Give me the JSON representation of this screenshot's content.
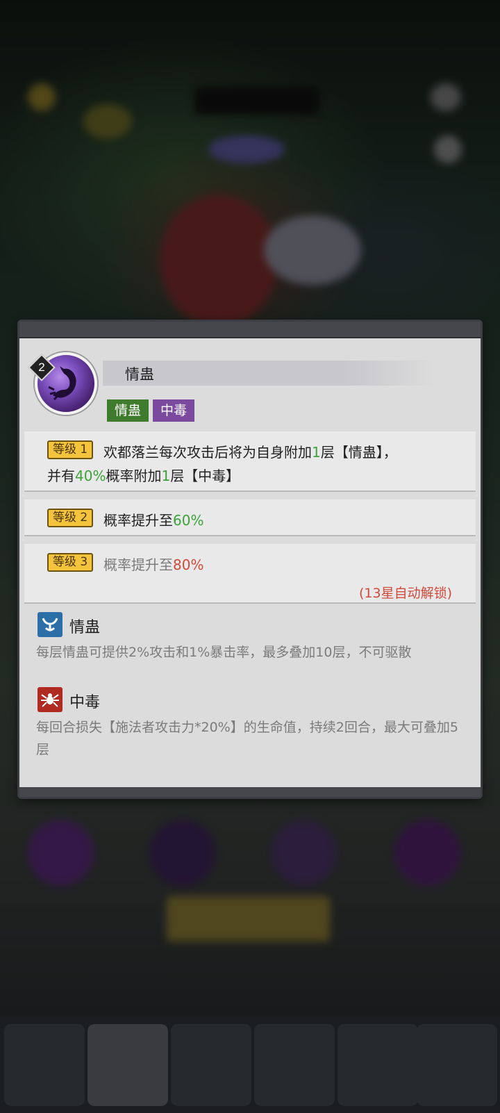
{
  "skill": {
    "level": "2",
    "name": "情蛊",
    "tags": [
      "情蛊",
      "中毒"
    ]
  },
  "levels": [
    {
      "badge": "等级 1",
      "line1": {
        "a": "欢都落兰每次攻击后将为自身附加",
        "b": "1",
        "c": "层【情蛊】，"
      },
      "line2": {
        "a": "并有",
        "b": "40%",
        "c": "概率附加",
        "d": "1",
        "e": "层【中毒】"
      }
    },
    {
      "badge": "等级 2",
      "line1": {
        "a": "概率提升至",
        "b": "60%"
      }
    },
    {
      "badge": "等级 3",
      "line1": {
        "a": "概率提升至",
        "b": "80%"
      },
      "note": "(13星自动解锁)"
    }
  ],
  "effects": [
    {
      "icon": "charm-icon",
      "title": "情蛊",
      "desc": "每层情蛊可提供2%攻击和1%暴击率，最多叠加10层，不可驱散"
    },
    {
      "icon": "spider-poison-icon",
      "title": "中毒",
      "desc": "每回合损失【施法者攻击力*20%】的生命值，持续2回合，最大可叠加5层"
    }
  ],
  "colors": {
    "tag_green": "#3f7b2d",
    "tag_purple": "#7b4a9e",
    "highlight_green": "#3ea13b",
    "highlight_red": "#cf4a3b",
    "badge_gold": "#f3c43c"
  }
}
